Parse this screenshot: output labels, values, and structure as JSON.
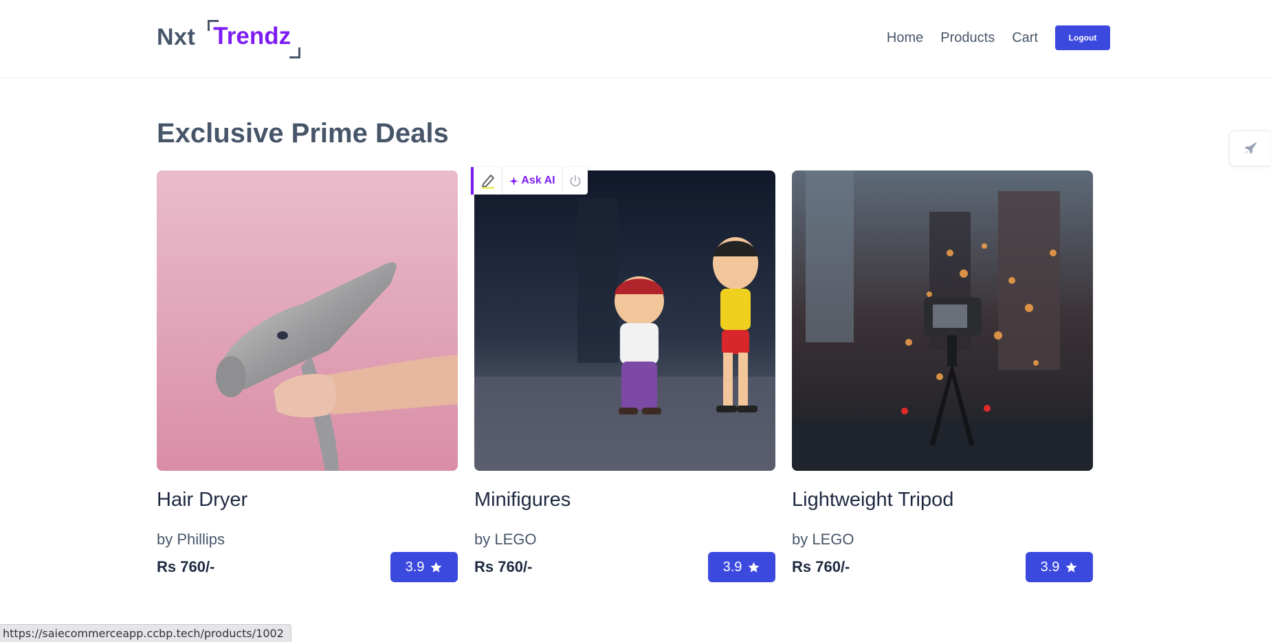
{
  "header": {
    "logo_part1": "Nxt",
    "logo_part2": "Trendz",
    "nav": [
      "Home",
      "Products",
      "Cart"
    ],
    "logout_label": "Logout"
  },
  "page_title": "Exclusive Prime Deals",
  "products": [
    {
      "title": "Hair Dryer",
      "brand": "by Phillips",
      "price": "Rs 760/-",
      "rating": "3.9"
    },
    {
      "title": "Minifigures",
      "brand": "by LEGO",
      "price": "Rs 760/-",
      "rating": "3.9"
    },
    {
      "title": "Lightweight Tripod",
      "brand": "by LEGO",
      "price": "Rs 760/-",
      "rating": "3.9"
    }
  ],
  "ai_toolbar": {
    "ask_label": "Ask AI"
  },
  "status_url": "https://saiecommerceapp.ccbp.tech/products/1002",
  "colors": {
    "accent": "#3b49df",
    "brand_purple": "#7c1cf2",
    "text": "#475569",
    "title": "#1e2940"
  }
}
